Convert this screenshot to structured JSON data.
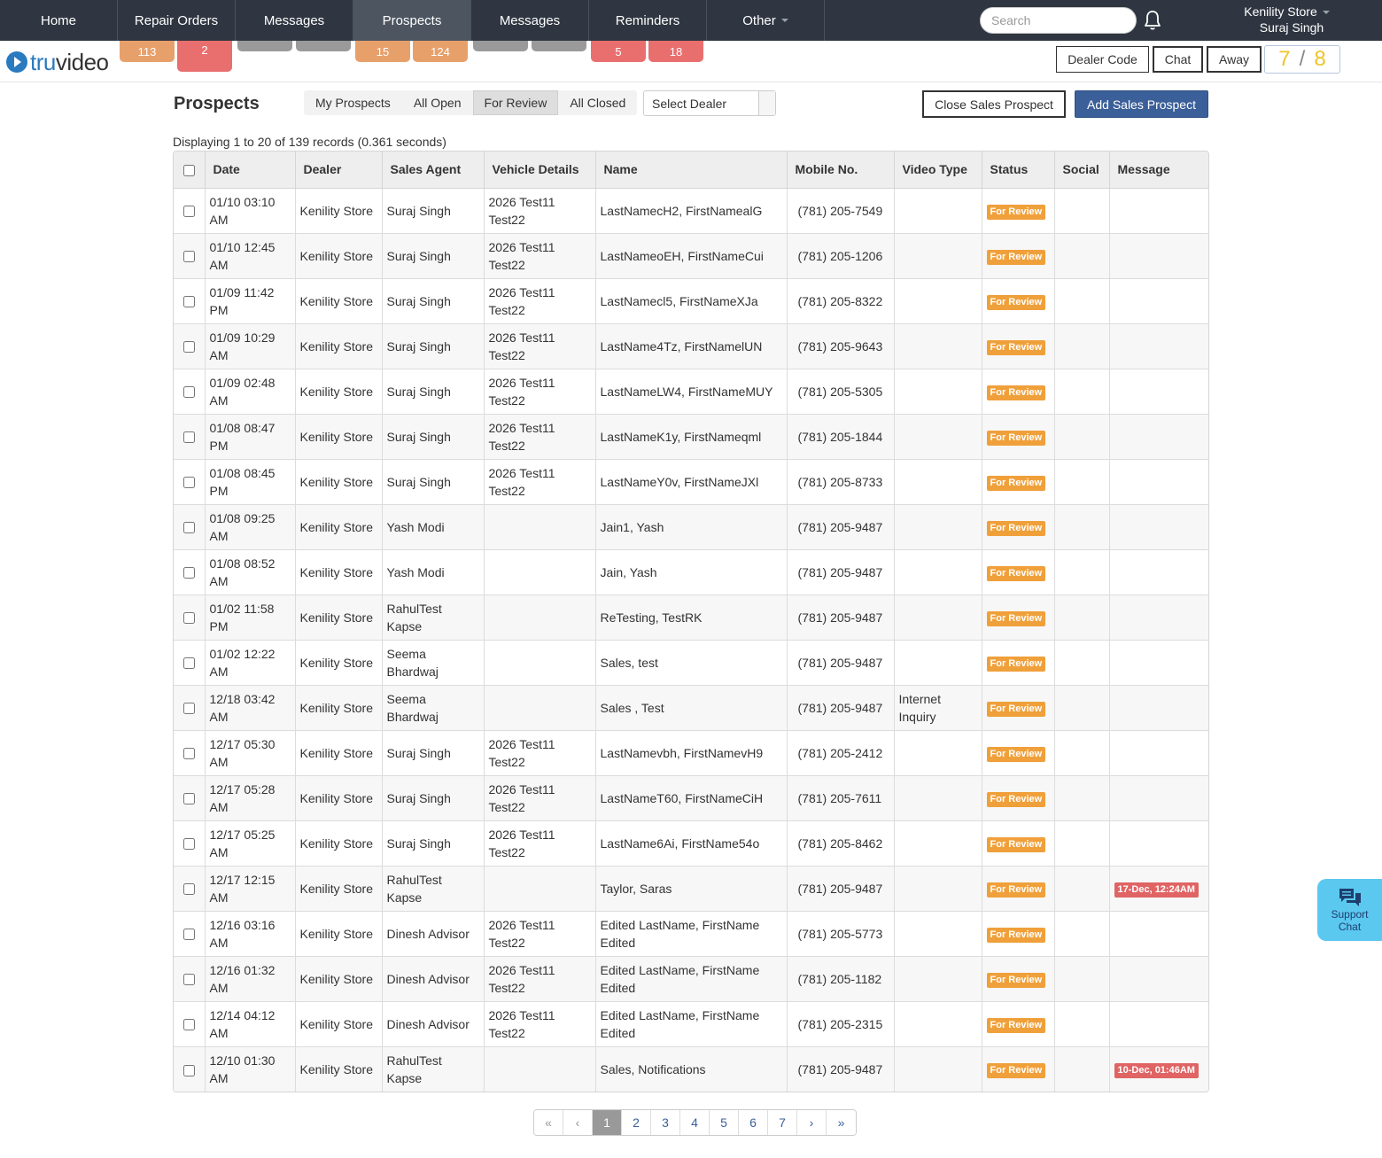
{
  "nav": {
    "items": [
      {
        "label": "Home"
      },
      {
        "label": "Repair Orders"
      },
      {
        "label": "Messages"
      },
      {
        "label": "Prospects"
      },
      {
        "label": "Messages"
      },
      {
        "label": "Reminders"
      },
      {
        "label": "Other"
      }
    ],
    "badges": [
      "113",
      "2",
      "15",
      "124",
      "5",
      "18"
    ],
    "search_placeholder": "Search",
    "store": "Kenility Store",
    "user": "Suraj Singh"
  },
  "header": {
    "logo_tru": "tru",
    "logo_video": "video",
    "dealer_code": "Dealer Code",
    "chat": "Chat",
    "away": "Away",
    "counter_a": "7",
    "counter_sep": "/",
    "counter_b": "8"
  },
  "toolbar": {
    "title": "Prospects",
    "filters": [
      "My Prospects",
      "All Open",
      "For Review",
      "All Closed"
    ],
    "select_dealer": "Select Dealer",
    "close_prospect": "Close Sales Prospect",
    "add_prospect": "Add Sales Prospect",
    "records": "Displaying 1 to 20 of 139 records (0.361 seconds)"
  },
  "table": {
    "headers": [
      "Date",
      "Dealer",
      "Sales Agent",
      "Vehicle Details",
      "Name",
      "Mobile No.",
      "Video Type",
      "Status",
      "Social",
      "Message"
    ],
    "rows": [
      {
        "date": "01/10 03:10 AM",
        "dealer": "Kenility Store",
        "agent": "Suraj Singh",
        "vehicle": "2026 Test11 Test22",
        "name": "LastNamecH2, FirstNamealG",
        "mobile": "(781) 205-7549",
        "video": "",
        "status": "For Review",
        "social": "",
        "message": ""
      },
      {
        "date": "01/10 12:45 AM",
        "dealer": "Kenility Store",
        "agent": "Suraj Singh",
        "vehicle": "2026 Test11 Test22",
        "name": "LastNameoEH, FirstNameCui",
        "mobile": "(781) 205-1206",
        "video": "",
        "status": "For Review",
        "social": "",
        "message": ""
      },
      {
        "date": "01/09 11:42 PM",
        "dealer": "Kenility Store",
        "agent": "Suraj Singh",
        "vehicle": "2026 Test11 Test22",
        "name": "LastNamecl5, FirstNameXJa",
        "mobile": "(781) 205-8322",
        "video": "",
        "status": "For Review",
        "social": "",
        "message": ""
      },
      {
        "date": "01/09 10:29 AM",
        "dealer": "Kenility Store",
        "agent": "Suraj Singh",
        "vehicle": "2026 Test11 Test22",
        "name": "LastName4Tz, FirstNamelUN",
        "mobile": "(781) 205-9643",
        "video": "",
        "status": "For Review",
        "social": "",
        "message": ""
      },
      {
        "date": "01/09 02:48 AM",
        "dealer": "Kenility Store",
        "agent": "Suraj Singh",
        "vehicle": "2026 Test11 Test22",
        "name": "LastNameLW4, FirstNameMUY",
        "mobile": "(781) 205-5305",
        "video": "",
        "status": "For Review",
        "social": "",
        "message": ""
      },
      {
        "date": "01/08 08:47 PM",
        "dealer": "Kenility Store",
        "agent": "Suraj Singh",
        "vehicle": "2026 Test11 Test22",
        "name": "LastNameK1y, FirstNameqml",
        "mobile": "(781) 205-1844",
        "video": "",
        "status": "For Review",
        "social": "",
        "message": ""
      },
      {
        "date": "01/08 08:45 PM",
        "dealer": "Kenility Store",
        "agent": "Suraj Singh",
        "vehicle": "2026 Test11 Test22",
        "name": "LastNameY0v, FirstNameJXl",
        "mobile": "(781) 205-8733",
        "video": "",
        "status": "For Review",
        "social": "",
        "message": ""
      },
      {
        "date": "01/08 09:25 AM",
        "dealer": "Kenility Store",
        "agent": "Yash Modi",
        "vehicle": "",
        "name": "Jain1, Yash",
        "mobile": "(781) 205-9487",
        "video": "",
        "status": "For Review",
        "social": "",
        "message": ""
      },
      {
        "date": "01/08 08:52 AM",
        "dealer": "Kenility Store",
        "agent": "Yash Modi",
        "vehicle": "",
        "name": "Jain, Yash",
        "mobile": "(781) 205-9487",
        "video": "",
        "status": "For Review",
        "social": "",
        "message": ""
      },
      {
        "date": "01/02 11:58 PM",
        "dealer": "Kenility Store",
        "agent": "RahulTest Kapse",
        "vehicle": "",
        "name": "ReTesting, TestRK",
        "mobile": "(781) 205-9487",
        "video": "",
        "status": "For Review",
        "social": "",
        "message": ""
      },
      {
        "date": "01/02 12:22 AM",
        "dealer": "Kenility Store",
        "agent": "Seema Bhardwaj",
        "vehicle": "",
        "name": "Sales, test",
        "mobile": "(781) 205-9487",
        "video": "",
        "status": "For Review",
        "social": "",
        "message": ""
      },
      {
        "date": "12/18 03:42 AM",
        "dealer": "Kenility Store",
        "agent": "Seema Bhardwaj",
        "vehicle": "",
        "name": "Sales , Test",
        "mobile": "(781) 205-9487",
        "video": "Internet Inquiry",
        "status": "For Review",
        "social": "",
        "message": ""
      },
      {
        "date": "12/17 05:30 AM",
        "dealer": "Kenility Store",
        "agent": "Suraj Singh",
        "vehicle": "2026 Test11 Test22",
        "name": "LastNamevbh, FirstNamevH9",
        "mobile": "(781) 205-2412",
        "video": "",
        "status": "For Review",
        "social": "",
        "message": ""
      },
      {
        "date": "12/17 05:28 AM",
        "dealer": "Kenility Store",
        "agent": "Suraj Singh",
        "vehicle": "2026 Test11 Test22",
        "name": "LastNameT60, FirstNameCiH",
        "mobile": "(781) 205-7611",
        "video": "",
        "status": "For Review",
        "social": "",
        "message": ""
      },
      {
        "date": "12/17 05:25 AM",
        "dealer": "Kenility Store",
        "agent": "Suraj Singh",
        "vehicle": "2026 Test11 Test22",
        "name": "LastName6Ai, FirstName54o",
        "mobile": "(781) 205-8462",
        "video": "",
        "status": "For Review",
        "social": "",
        "message": ""
      },
      {
        "date": "12/17 12:15 AM",
        "dealer": "Kenility Store",
        "agent": "RahulTest Kapse",
        "vehicle": "",
        "name": "Taylor, Saras",
        "mobile": "(781) 205-9487",
        "video": "",
        "status": "For Review",
        "social": "",
        "message": "17-Dec, 12:24AM"
      },
      {
        "date": "12/16 03:16 AM",
        "dealer": "Kenility Store",
        "agent": "Dinesh Advisor",
        "vehicle": "2026 Test11 Test22",
        "name": "Edited LastName, FirstName Edited",
        "mobile": "(781) 205-5773",
        "video": "",
        "status": "For Review",
        "social": "",
        "message": ""
      },
      {
        "date": "12/16 01:32 AM",
        "dealer": "Kenility Store",
        "agent": "Dinesh Advisor",
        "vehicle": "2026 Test11 Test22",
        "name": "Edited LastName, FirstName Edited",
        "mobile": "(781) 205-1182",
        "video": "",
        "status": "For Review",
        "social": "",
        "message": ""
      },
      {
        "date": "12/14 04:12 AM",
        "dealer": "Kenility Store",
        "agent": "Dinesh Advisor",
        "vehicle": "2026 Test11 Test22",
        "name": "Edited LastName, FirstName Edited",
        "mobile": "(781) 205-2315",
        "video": "",
        "status": "For Review",
        "social": "",
        "message": ""
      },
      {
        "date": "12/10 01:30 AM",
        "dealer": "Kenility Store",
        "agent": "RahulTest Kapse",
        "vehicle": "",
        "name": "Sales, Notifications",
        "mobile": "(781) 205-9487",
        "video": "",
        "status": "For Review",
        "social": "",
        "message": "10-Dec, 01:46AM"
      }
    ]
  },
  "pagination": [
    "«",
    "‹",
    "1",
    "2",
    "3",
    "4",
    "5",
    "6",
    "7",
    "›",
    "»"
  ],
  "support": {
    "line1": "Support",
    "line2": "Chat"
  },
  "colors": {
    "nav_bg": "#2f3641",
    "status": "#f0a03a",
    "message": "#e06464",
    "primary": "#3b5f99",
    "support": "#5bc8f0"
  }
}
